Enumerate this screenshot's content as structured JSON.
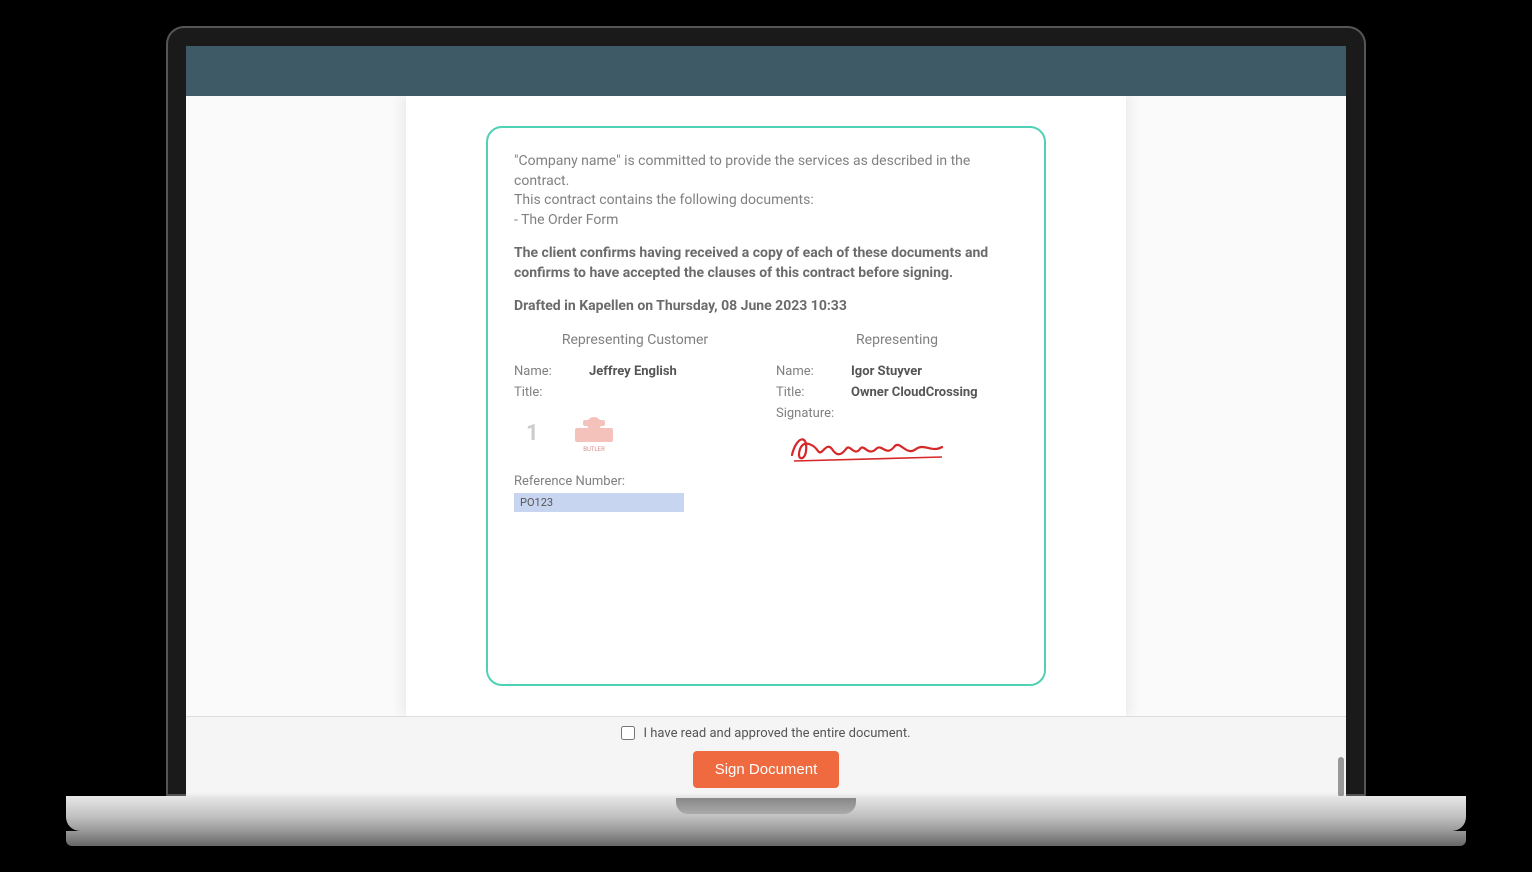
{
  "contract": {
    "intro_line1": "\"Company name\" is committed to provide the services as described in the contract.",
    "intro_line2": "This contract contains the following documents:",
    "intro_line3": "- The Order Form",
    "confirm": "The client confirms having received a copy of each of these documents and confirms to have accepted the clauses of this contract before signing.",
    "drafted": "Drafted in Kapellen on Thursday, 08 June 2023 10:33",
    "left": {
      "heading": "Representing Customer",
      "name_label": "Name:",
      "name_value": "Jeffrey English",
      "title_label": "Title:",
      "title_value": "",
      "stamp_number": "1",
      "stamp_caption": "BUTLER"
    },
    "right": {
      "heading": "Representing",
      "name_label": "Name:",
      "name_value": "Igor Stuyver",
      "title_label": "Title:",
      "title_value": "Owner CloudCrossing",
      "signature_label": "Signature:",
      "signature_text": "Signature"
    },
    "ref_label": "Reference Number:",
    "ref_value": "PO123"
  },
  "footer": {
    "approve_label": "I have read and approved the entire document.",
    "sign_button": "Sign Document"
  }
}
